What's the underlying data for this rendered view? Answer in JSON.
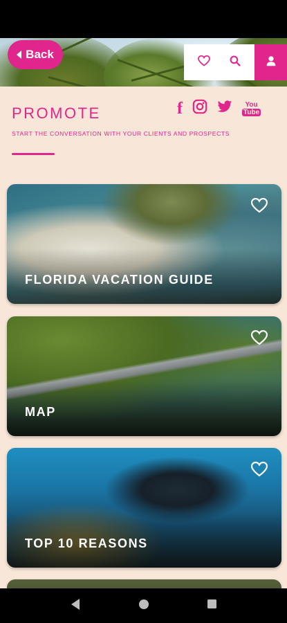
{
  "header": {
    "back_label": "Back"
  },
  "promote": {
    "title": "PROMOTE",
    "subtitle": "START THE CONVERSATION WITH YOUR CLIENTS AND PROSPECTS",
    "social": [
      {
        "name": "facebook-icon",
        "text": "f"
      },
      {
        "name": "instagram-icon",
        "text": ""
      },
      {
        "name": "twitter-icon",
        "text": ""
      },
      {
        "name": "youtube-icon",
        "text_top": "You",
        "text_bottom": "Tube"
      }
    ]
  },
  "cards": [
    {
      "label": "FLORIDA VACATION GUIDE",
      "favorite": false
    },
    {
      "label": "MAP",
      "favorite": false
    },
    {
      "label": "TOP 10 REASONS",
      "favorite": false
    }
  ],
  "colors": {
    "accent": "#e0268c",
    "background": "#f8e6d8"
  },
  "icons": [
    "back-arrow-icon",
    "heart-icon",
    "search-icon",
    "user-icon",
    "nav-back-icon",
    "nav-home-icon",
    "nav-recents-icon"
  ]
}
